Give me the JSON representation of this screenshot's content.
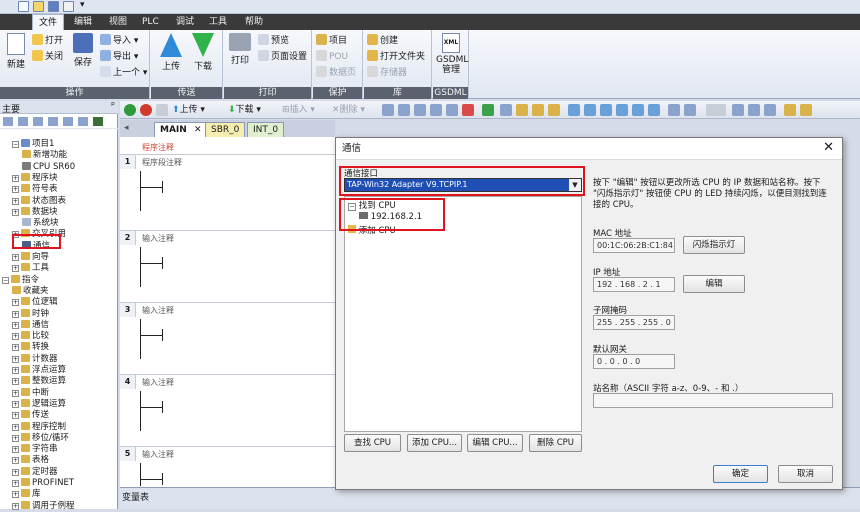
{
  "menu": [
    "文件",
    "编辑",
    "视图",
    "PLC",
    "调试",
    "工具",
    "帮助"
  ],
  "ribbon": {
    "groups": {
      "operation": "操作",
      "transfer": "传送",
      "print": "打印",
      "protect": "保护",
      "library": "库",
      "gsdml": "GSDML"
    },
    "new": "新建",
    "open": "打开",
    "close": "关闭",
    "save": "保存",
    "import": "导入",
    "export": "导出",
    "previous": "上一个",
    "upload": "上传",
    "download": "下载",
    "print": "打印",
    "preview": "预览",
    "page_setup": "页面设置",
    "project": "项目",
    "pou": "POU",
    "data_page": "数据页",
    "create": "创建",
    "open_folder": "打开文件夹",
    "memory": "存储器",
    "gsdml_manage": "GSDML\n管理"
  },
  "toolbar": {
    "upload": "上传",
    "download": "下载",
    "insert": "插入",
    "delete": "删除"
  },
  "left_pane": {
    "header": "主要",
    "tree": [
      {
        "label": "项目1",
        "indent": 1,
        "exp": "−"
      },
      {
        "label": "新增功能",
        "indent": 2,
        "exp": ""
      },
      {
        "label": "CPU SR60",
        "indent": 2,
        "exp": ""
      },
      {
        "label": "程序块",
        "indent": 1,
        "exp": "+"
      },
      {
        "label": "符号表",
        "indent": 1,
        "exp": "+"
      },
      {
        "label": "状态图表",
        "indent": 1,
        "exp": "+"
      },
      {
        "label": "数据块",
        "indent": 1,
        "exp": "+"
      },
      {
        "label": "系统块",
        "indent": 2,
        "exp": ""
      },
      {
        "label": "交叉引用",
        "indent": 1,
        "exp": "+"
      },
      {
        "label": "通信",
        "indent": 2,
        "exp": ""
      },
      {
        "label": "向导",
        "indent": 1,
        "exp": "+"
      },
      {
        "label": "工具",
        "indent": 1,
        "exp": "+"
      },
      {
        "label": "指令",
        "indent": 0,
        "exp": "−"
      },
      {
        "label": "收藏夹",
        "indent": 1,
        "exp": ""
      },
      {
        "label": "位逻辑",
        "indent": 1,
        "exp": "+"
      },
      {
        "label": "时钟",
        "indent": 1,
        "exp": "+"
      },
      {
        "label": "通信",
        "indent": 1,
        "exp": "+"
      },
      {
        "label": "比较",
        "indent": 1,
        "exp": "+"
      },
      {
        "label": "转换",
        "indent": 1,
        "exp": "+"
      },
      {
        "label": "计数器",
        "indent": 1,
        "exp": "+"
      },
      {
        "label": "浮点运算",
        "indent": 1,
        "exp": "+"
      },
      {
        "label": "整数运算",
        "indent": 1,
        "exp": "+"
      },
      {
        "label": "中断",
        "indent": 1,
        "exp": "+"
      },
      {
        "label": "逻辑运算",
        "indent": 1,
        "exp": "+"
      },
      {
        "label": "传送",
        "indent": 1,
        "exp": "+"
      },
      {
        "label": "程序控制",
        "indent": 1,
        "exp": "+"
      },
      {
        "label": "移位/循环",
        "indent": 1,
        "exp": "+"
      },
      {
        "label": "字符串",
        "indent": 1,
        "exp": "+"
      },
      {
        "label": "表格",
        "indent": 1,
        "exp": "+"
      },
      {
        "label": "定时器",
        "indent": 1,
        "exp": "+"
      },
      {
        "label": "PROFINET",
        "indent": 1,
        "exp": "+"
      },
      {
        "label": "库",
        "indent": 1,
        "exp": "+"
      },
      {
        "label": "调用子例程",
        "indent": 1,
        "exp": "+"
      }
    ]
  },
  "editor": {
    "tabs": [
      "MAIN",
      "SBR_0",
      "INT_0"
    ],
    "program_comment": "程序注释",
    "rungs": [
      {
        "num": "1",
        "comment": "程序段注释"
      },
      {
        "num": "2",
        "comment": "输入注释"
      },
      {
        "num": "3",
        "comment": "输入注释"
      },
      {
        "num": "4",
        "comment": "输入注释"
      },
      {
        "num": "5",
        "comment": "输入注释"
      }
    ]
  },
  "var_table": "变量表",
  "dialog": {
    "title": "通信",
    "interface_label": "通信接口",
    "interface_value": "TAP-Win32 Adapter V9.TCPIP.1",
    "found_cpu": "找到 CPU",
    "cpu_ip": "192.168.2.1",
    "add_cpu_node": "添加 CPU",
    "instructions": "按下 \"编辑\" 按钮以更改所选 CPU 的 IP 数据和站名称。按下 \"闪烁指示灯\" 按钮使 CPU 的 LED 持续闪烁，以便目测找到连接的 CPU。",
    "mac_label": "MAC 地址",
    "mac_value": "00:1C:06:2B:C1:84",
    "flash_button": "闪烁指示灯",
    "ip_label": "IP 地址",
    "ip_value": "192 . 168 .  2  .  1",
    "edit_button": "编辑",
    "subnet_label": "子网掩码",
    "subnet_value": "255 . 255 . 255 .  0",
    "gateway_label": "默认网关",
    "gateway_value": "0 .  0  .  0  .  0",
    "station_label": "站名称（ASCII 字符 a-z、0-9、- 和 .）",
    "find_button": "查找 CPU",
    "add_button": "添加 CPU...",
    "edit_cpu_button": "编辑 CPU...",
    "delete_button": "删除 CPU",
    "ok_button": "确定",
    "cancel_button": "取消"
  },
  "colors": {
    "highlight": "#e0141e",
    "selected_row": "#1f4fb4",
    "dark_menu": "#3a3a3a"
  }
}
